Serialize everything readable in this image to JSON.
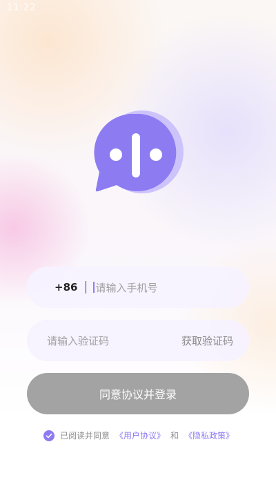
{
  "status_bar": {
    "time": "11:22"
  },
  "login_form": {
    "country_code": "+86",
    "phone_placeholder": "请输入手机号",
    "code_placeholder": "请输入验证码",
    "get_code_label": "获取验证码",
    "submit_label": "同意协议并登录"
  },
  "agreement": {
    "checked": true,
    "prefix": "已阅读并同意",
    "user_agreement_link": "《用户协议》",
    "conjunction": "和",
    "privacy_policy_link": "《隐私政策》"
  },
  "colors": {
    "accent": "#8d7bf2",
    "button_disabled": "#a3a3a3",
    "field_background": "#f6f2ff"
  },
  "icons": {
    "logo": "chat-bubble-logo-icon",
    "checkbox": "check-icon"
  }
}
